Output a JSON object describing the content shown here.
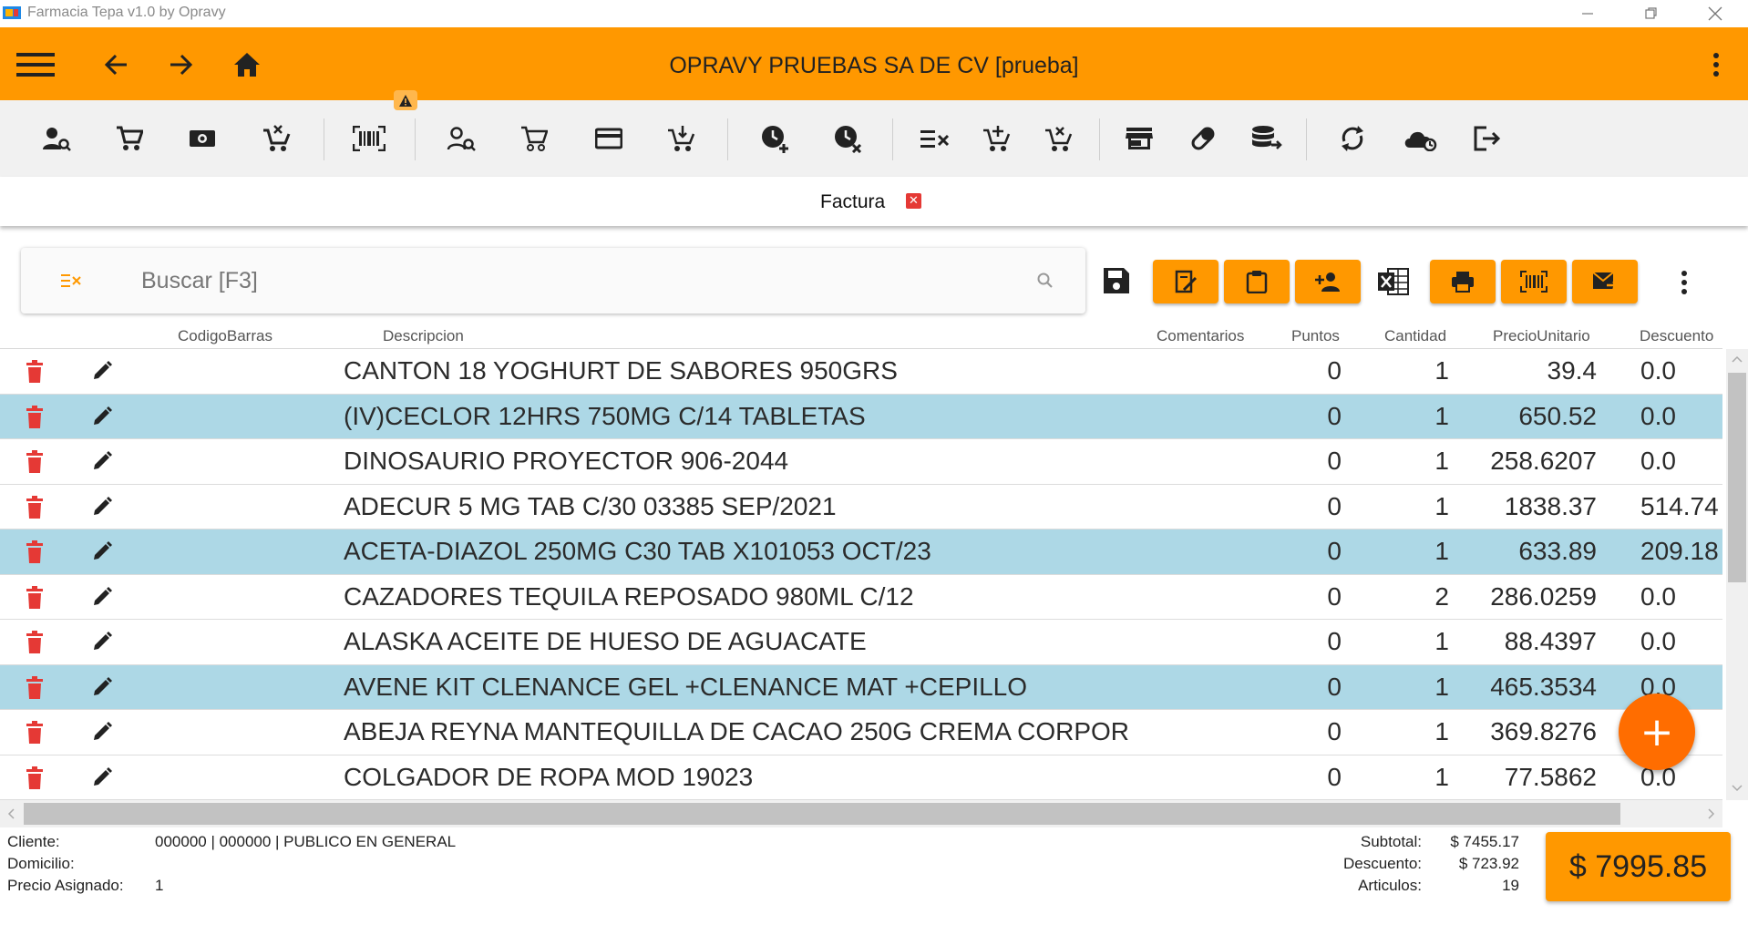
{
  "window": {
    "title": "Farmacia Tepa v1.0 by Opravy"
  },
  "appbar": {
    "company": "OPRAVY PRUEBAS SA DE CV [prueba]"
  },
  "tab": {
    "label": "Factura",
    "close": "✕"
  },
  "search": {
    "placeholder": "Buscar [F3]"
  },
  "columns": {
    "codigo": "CodigoBarras",
    "descripcion": "Descripcion",
    "comentarios": "Comentarios",
    "puntos": "Puntos",
    "cantidad": "Cantidad",
    "precio": "PrecioUnitario",
    "descuento": "Descuento"
  },
  "rows": [
    {
      "descripcion": "CANTON 18 YOGHURT DE SABORES 950GRS",
      "puntos": "0",
      "cantidad": "1",
      "precio": "39.4",
      "descuento": "0.0",
      "selected": false
    },
    {
      "descripcion": "(IV)CECLOR 12HRS 750MG C/14 TABLETAS",
      "puntos": "0",
      "cantidad": "1",
      "precio": "650.52",
      "descuento": "0.0",
      "selected": true
    },
    {
      "descripcion": "DINOSAURIO PROYECTOR 906-2044",
      "puntos": "0",
      "cantidad": "1",
      "precio": "258.6207",
      "descuento": "0.0",
      "selected": false
    },
    {
      "descripcion": "ADECUR 5 MG TAB C/30 03385  SEP/2021",
      "puntos": "0",
      "cantidad": "1",
      "precio": "1838.37",
      "descuento": "514.74",
      "selected": false
    },
    {
      "descripcion": "ACETA-DIAZOL 250MG C30 TAB X101053   OCT/23",
      "puntos": "0",
      "cantidad": "1",
      "precio": "633.89",
      "descuento": "209.18",
      "selected": true
    },
    {
      "descripcion": "CAZADORES TEQUILA REPOSADO 980ML C/12",
      "puntos": "0",
      "cantidad": "2",
      "precio": "286.0259",
      "descuento": "0.0",
      "selected": false
    },
    {
      "descripcion": "ALASKA ACEITE DE HUESO DE AGUACATE",
      "puntos": "0",
      "cantidad": "1",
      "precio": "88.4397",
      "descuento": "0.0",
      "selected": false
    },
    {
      "descripcion": "AVENE KIT CLENANCE GEL +CLENANCE MAT  +CEPILLO",
      "puntos": "0",
      "cantidad": "1",
      "precio": "465.3534",
      "descuento": "0.0",
      "selected": true
    },
    {
      "descripcion": "ABEJA REYNA MANTEQUILLA DE CACAO 250G CREMA CORPOR",
      "puntos": "0",
      "cantidad": "1",
      "precio": "369.8276",
      "descuento": "",
      "selected": false
    },
    {
      "descripcion": "COLGADOR DE ROPA MOD 19023",
      "puntos": "0",
      "cantidad": "1",
      "precio": "77.5862",
      "descuento": "0.0",
      "selected": false
    }
  ],
  "fab": {
    "label": "+"
  },
  "footer": {
    "cliente_label": "Cliente:",
    "cliente_value": "000000 | 000000 | PUBLICO EN GENERAL",
    "domicilio_label": "Domicilio:",
    "precio_label": "Precio Asignado:",
    "precio_value": "1",
    "subtotal_label": "Subtotal:",
    "subtotal_value": "$ 7455.17",
    "descuento_label": "Descuento:",
    "descuento_value": "$ 723.92",
    "articulos_label": "Articulos:",
    "articulos_value": "19",
    "total": "$ 7995.85"
  },
  "colors": {
    "accent": "#FF9800",
    "fab": "#FF6D00",
    "selected_row": "#ADD8E6",
    "delete": "#e53935"
  }
}
